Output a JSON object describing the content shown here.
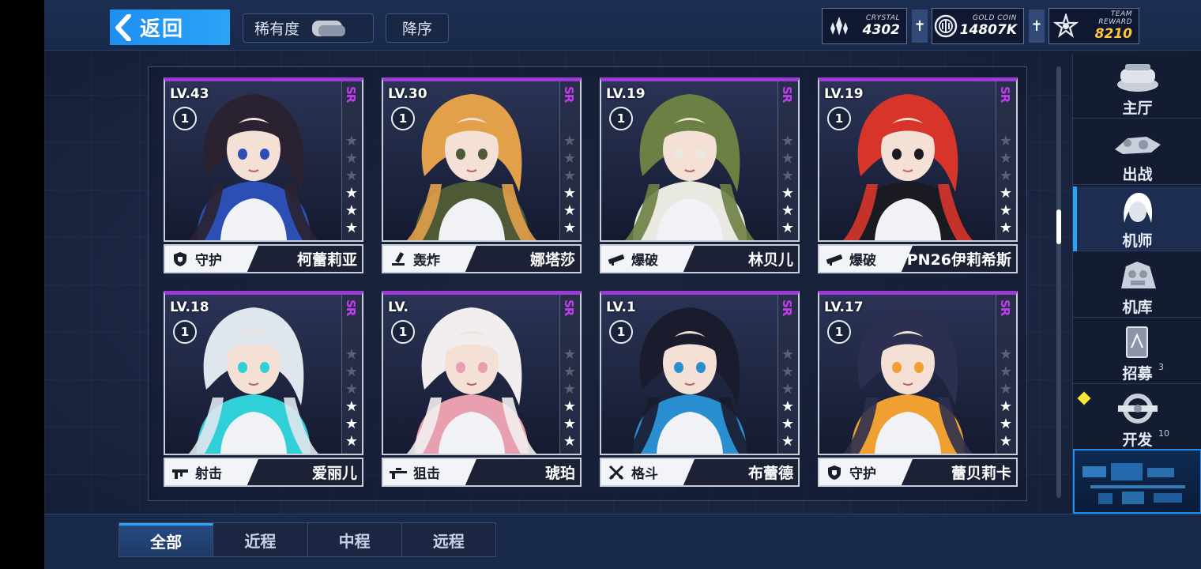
{
  "topbar": {
    "back_label": "返回",
    "rarity_label": "稀有度",
    "order_label": "降序"
  },
  "resources": {
    "crystal": {
      "label": "CRYSTAL",
      "value": "4302",
      "icon": "crystal-icon"
    },
    "gold": {
      "label": "GOLD COIN",
      "value": "14807K",
      "icon": "gold-coin-icon"
    },
    "team": {
      "label": "TEAM REWARD",
      "value": "8210",
      "icon": "team-reward-icon"
    },
    "plus_label": "✝"
  },
  "colors": {
    "accent": "#2aa4f7",
    "rank_sr": "#c13bf0",
    "team_reward": "#ffc83a"
  },
  "cards": [
    {
      "level": "LV.43",
      "badge": "1",
      "rank": "SR",
      "stars": 3,
      "role": "守护",
      "role_icon": "shield-icon",
      "name": "柯蕾莉亚",
      "hair": "#2a2230",
      "accent": "#2c4fb5"
    },
    {
      "level": "LV.30",
      "badge": "1",
      "rank": "SR",
      "stars": 3,
      "role": "轰炸",
      "role_icon": "mortar-icon",
      "name": "娜塔莎",
      "hair": "#e3a04a",
      "accent": "#4e5a36"
    },
    {
      "level": "LV.19",
      "badge": "1",
      "rank": "SR",
      "stars": 3,
      "role": "爆破",
      "role_icon": "launcher-icon",
      "name": "林贝儿",
      "hair": "#6d8044",
      "accent": "#e9e9e2"
    },
    {
      "level": "LV.19",
      "badge": "1",
      "rank": "SR",
      "stars": 3,
      "role": "爆破",
      "role_icon": "launcher-icon",
      "name": "PN26伊莉希斯",
      "hair": "#d8352a",
      "accent": "#1a1a22"
    },
    {
      "level": "LV.18",
      "badge": "1",
      "rank": "SR",
      "stars": 3,
      "role": "射击",
      "role_icon": "rifle-icon",
      "name": "爱丽儿",
      "hair": "#dfe6ee",
      "accent": "#2fd0d8"
    },
    {
      "level": "LV.",
      "badge": "1",
      "rank": "SR",
      "stars": 3,
      "role": "狙击",
      "role_icon": "sniper-icon",
      "name": "琥珀",
      "hair": "#f2eef0",
      "accent": "#e8a0b0"
    },
    {
      "level": "LV.1",
      "badge": "1",
      "rank": "SR",
      "stars": 3,
      "role": "格斗",
      "role_icon": "swords-icon",
      "name": "布蕾德",
      "hair": "#1b1b2e",
      "accent": "#2a8fd0"
    },
    {
      "level": "LV.17",
      "badge": "1",
      "rank": "SR",
      "stars": 3,
      "role": "守护",
      "role_icon": "shield-icon",
      "name": "蕾贝莉卡",
      "hair": "#2c2f4f",
      "accent": "#f0a030"
    }
  ],
  "nav": [
    {
      "label": "主厅",
      "icon": "hall-icon",
      "count": ""
    },
    {
      "label": "出战",
      "icon": "sortie-icon",
      "count": ""
    },
    {
      "label": "机师",
      "icon": "pilot-icon",
      "count": "",
      "active": true
    },
    {
      "label": "机库",
      "icon": "hangar-icon",
      "count": ""
    },
    {
      "label": "招募",
      "icon": "recruit-icon",
      "count": "3"
    },
    {
      "label": "开发",
      "icon": "develop-icon",
      "count": "10",
      "new": true
    }
  ],
  "tabs": [
    {
      "label": "全部",
      "active": true
    },
    {
      "label": "近程"
    },
    {
      "label": "中程"
    },
    {
      "label": "远程"
    }
  ]
}
